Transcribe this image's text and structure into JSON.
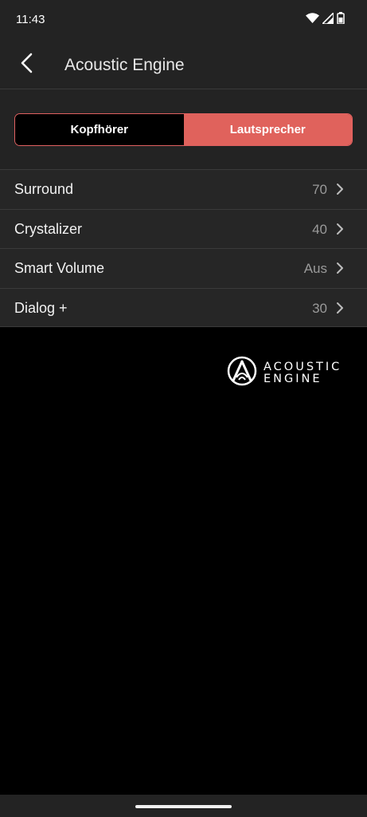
{
  "status_bar": {
    "time": "11:43",
    "icons": [
      "wifi-icon",
      "signal-icon",
      "battery-icon"
    ]
  },
  "app_bar": {
    "back_icon": "back-arrow-icon",
    "title": "Acoustic Engine"
  },
  "output_toggle": {
    "options": [
      {
        "label": "Kopfhörer",
        "selected": false
      },
      {
        "label": "Lautsprecher",
        "selected": true
      }
    ],
    "accent_color": "#e0625c"
  },
  "settings": [
    {
      "label": "Surround",
      "value": "70"
    },
    {
      "label": "Crystalizer",
      "value": "40"
    },
    {
      "label": "Smart Volume",
      "value": "Aus"
    },
    {
      "label": "Dialog +",
      "value": "30"
    }
  ],
  "logo": {
    "line1": "ACOUSTIC",
    "line2": "ENGINE"
  }
}
